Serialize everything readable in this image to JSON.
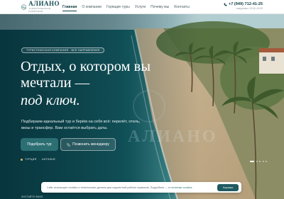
{
  "header": {
    "logo_text": "АЛИАНО",
    "logo_sub": "ТУРИСТИЧЕСКАЯ КОМПАНИЯ",
    "nav": [
      {
        "label": "Главная",
        "active": true
      },
      {
        "label": "О компании",
        "active": false
      },
      {
        "label": "Горящие туры",
        "active": false
      },
      {
        "label": "Услуги",
        "active": false
      },
      {
        "label": "Почему мы",
        "active": false
      },
      {
        "label": "Контакты",
        "active": false
      }
    ],
    "phone": "+7 (949) 712-41-25",
    "hours": "ежедневно 10:00–20:00"
  },
  "hero": {
    "badge": "ТУРИСТИЧЕСКАЯ КОМПАНИЯ · ВСЕ НАПРАВЛЕНИЯ",
    "title": "Отдых, о котором вы мечтали —",
    "title_accent": "под ключ.",
    "subtitle": "Подбираем идеальный тур и берём на себя всё: перелёт, отель, визы и трансфер. Вам остаётся выбрать даты.",
    "primary_button": "Подобрать тур",
    "secondary_button": "Позвонить менеджеру",
    "breadcrumb": [
      "ТУРЦИЯ",
      "АНТАЛЬЯ"
    ],
    "watermark": "АЛИАНО",
    "slides": {
      "count": 5,
      "active": 0
    }
  },
  "cookie": {
    "text": "Сайт использует cookies и технические данные для корректной работы сервисов. Подробнее — в ",
    "link": "политике cookies",
    "after_link": ".",
    "button": "Хорошо"
  },
  "scroll_hint": "ЛИСТАЙТЕ ВНИЗ",
  "colors": {
    "brand": "#134a52",
    "accent_button": "#2c6f73",
    "gold": "#d7b96a"
  },
  "icons": {
    "logo": "wave-logo-icon",
    "phone": "phone-icon",
    "call_button": "phone-icon",
    "breadcrumb": "location-dot-icon"
  }
}
